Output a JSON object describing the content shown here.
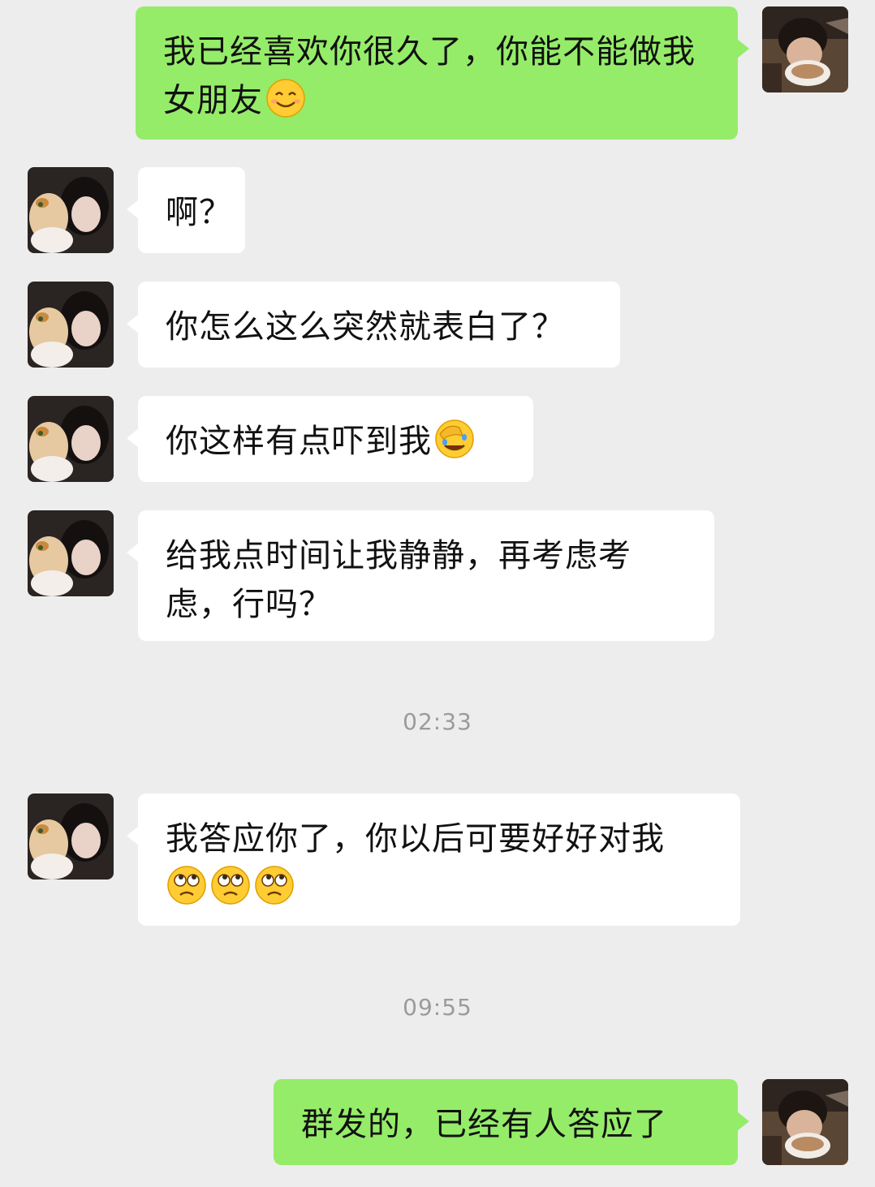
{
  "messages": [
    {
      "sender": "me",
      "text": "我已经喜欢你很久了，你能不能做我女朋友",
      "emojis": [
        "smiling-face"
      ]
    },
    {
      "sender": "her",
      "text": "啊？"
    },
    {
      "sender": "her",
      "text": "你怎么这么突然就表白了？"
    },
    {
      "sender": "her",
      "text": "你这样有点吓到我",
      "emojis": [
        "facepalm"
      ]
    },
    {
      "sender": "her",
      "text": "给我点时间让我静静，再考虑考虑，行吗？"
    },
    {
      "sender": "her",
      "text": "我答应你了，你以后可要好好对我",
      "emojis": [
        "eye-roll",
        "eye-roll",
        "eye-roll"
      ]
    },
    {
      "sender": "me",
      "text": "群发的，已经有人答应了"
    }
  ],
  "timestamps": [
    "02:33",
    "09:55"
  ],
  "colors": {
    "background": "#ededed",
    "outgoing_bubble": "#95ec69",
    "incoming_bubble": "#ffffff",
    "timestamp": "#9b9b9b"
  }
}
